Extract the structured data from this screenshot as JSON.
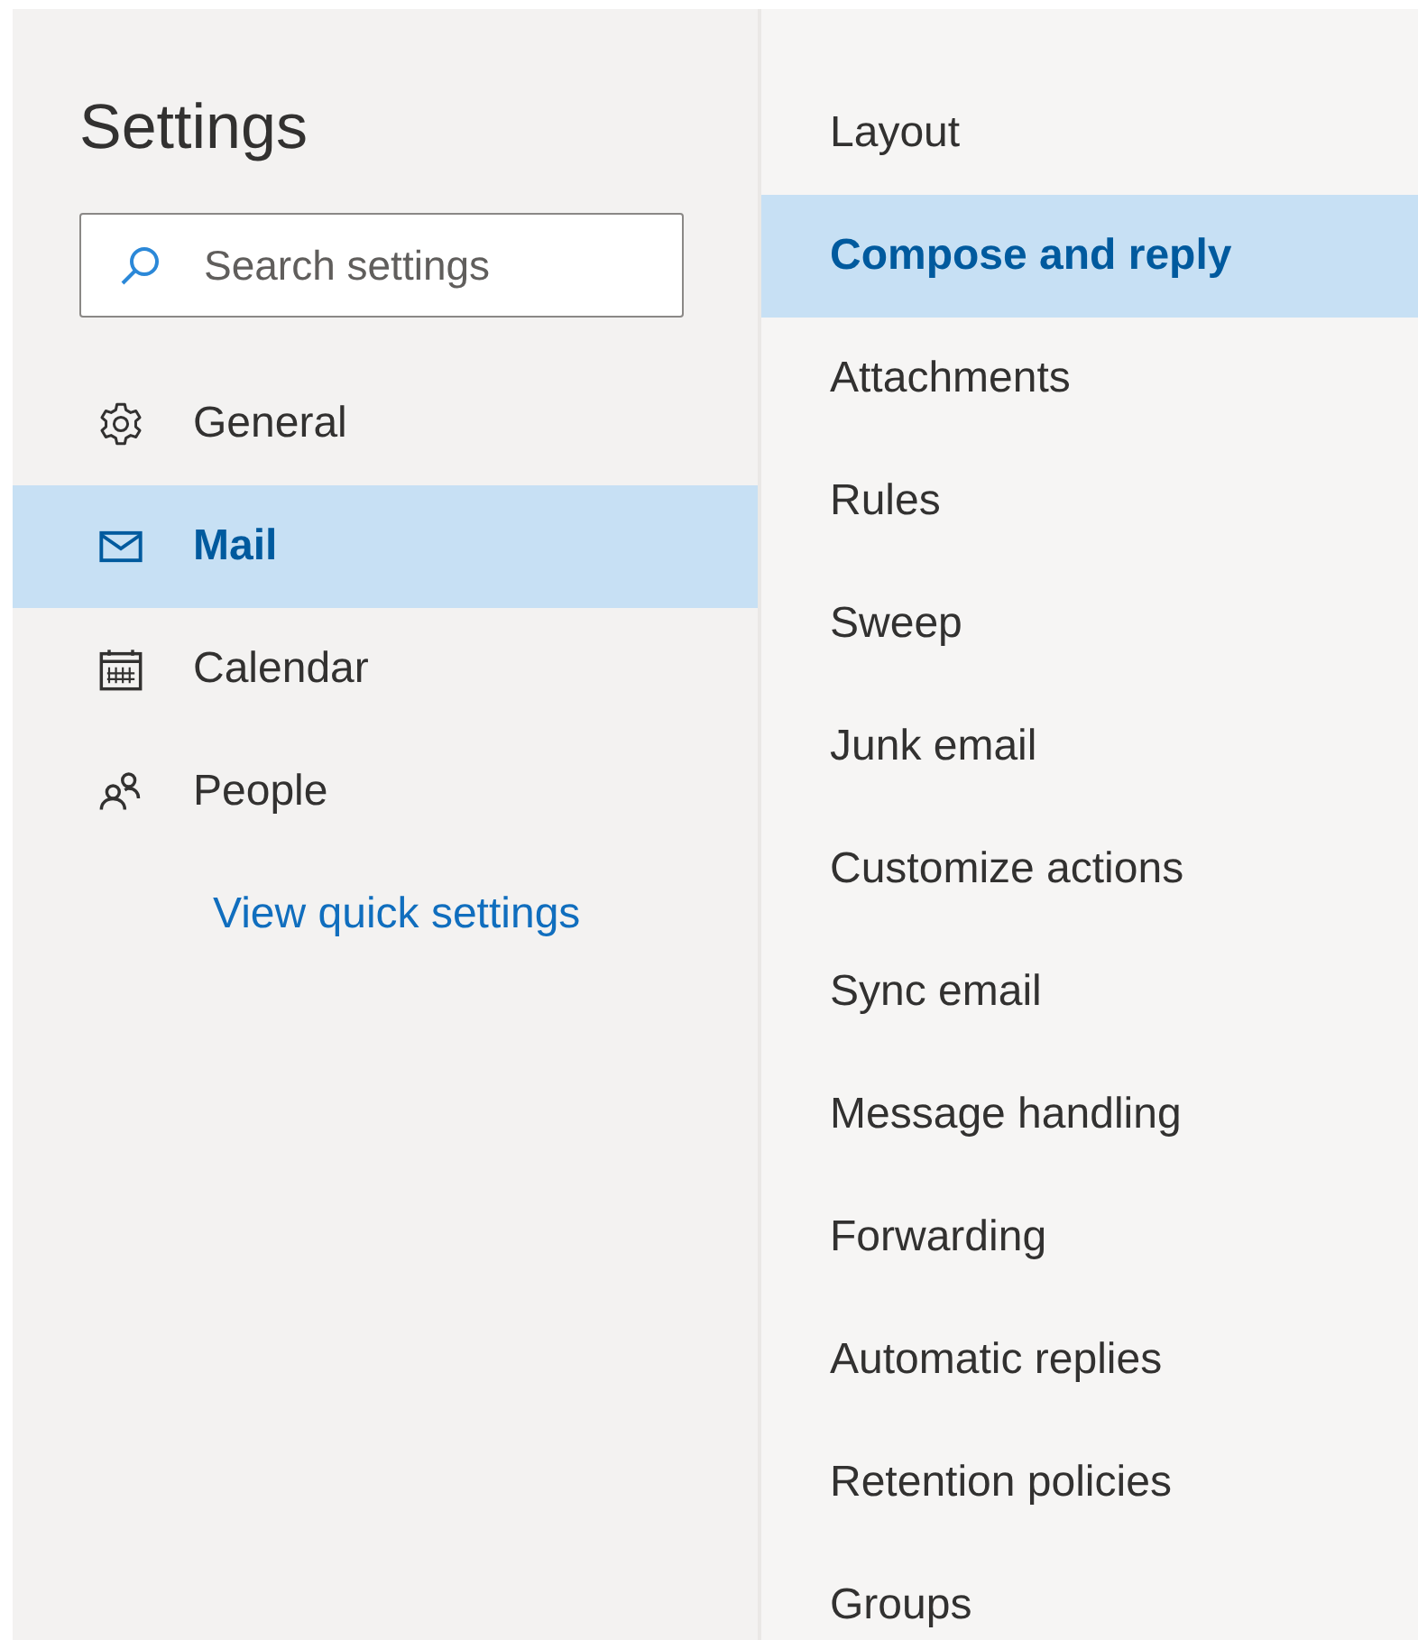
{
  "title": "Settings",
  "search": {
    "placeholder": "Search settings"
  },
  "nav": [
    {
      "label": "General",
      "kind": "gear",
      "selected": false
    },
    {
      "label": "Mail",
      "kind": "mail",
      "selected": true
    },
    {
      "label": "Calendar",
      "kind": "calendar",
      "selected": false
    },
    {
      "label": "People",
      "kind": "people",
      "selected": false
    }
  ],
  "quick_link": "View quick settings",
  "subnav": [
    {
      "label": "Layout",
      "selected": false
    },
    {
      "label": "Compose and reply",
      "selected": true
    },
    {
      "label": "Attachments",
      "selected": false
    },
    {
      "label": "Rules",
      "selected": false
    },
    {
      "label": "Sweep",
      "selected": false
    },
    {
      "label": "Junk email",
      "selected": false
    },
    {
      "label": "Customize actions",
      "selected": false
    },
    {
      "label": "Sync email",
      "selected": false
    },
    {
      "label": "Message handling",
      "selected": false
    },
    {
      "label": "Forwarding",
      "selected": false
    },
    {
      "label": "Automatic replies",
      "selected": false
    },
    {
      "label": "Retention policies",
      "selected": false
    },
    {
      "label": "Groups",
      "selected": false
    }
  ]
}
